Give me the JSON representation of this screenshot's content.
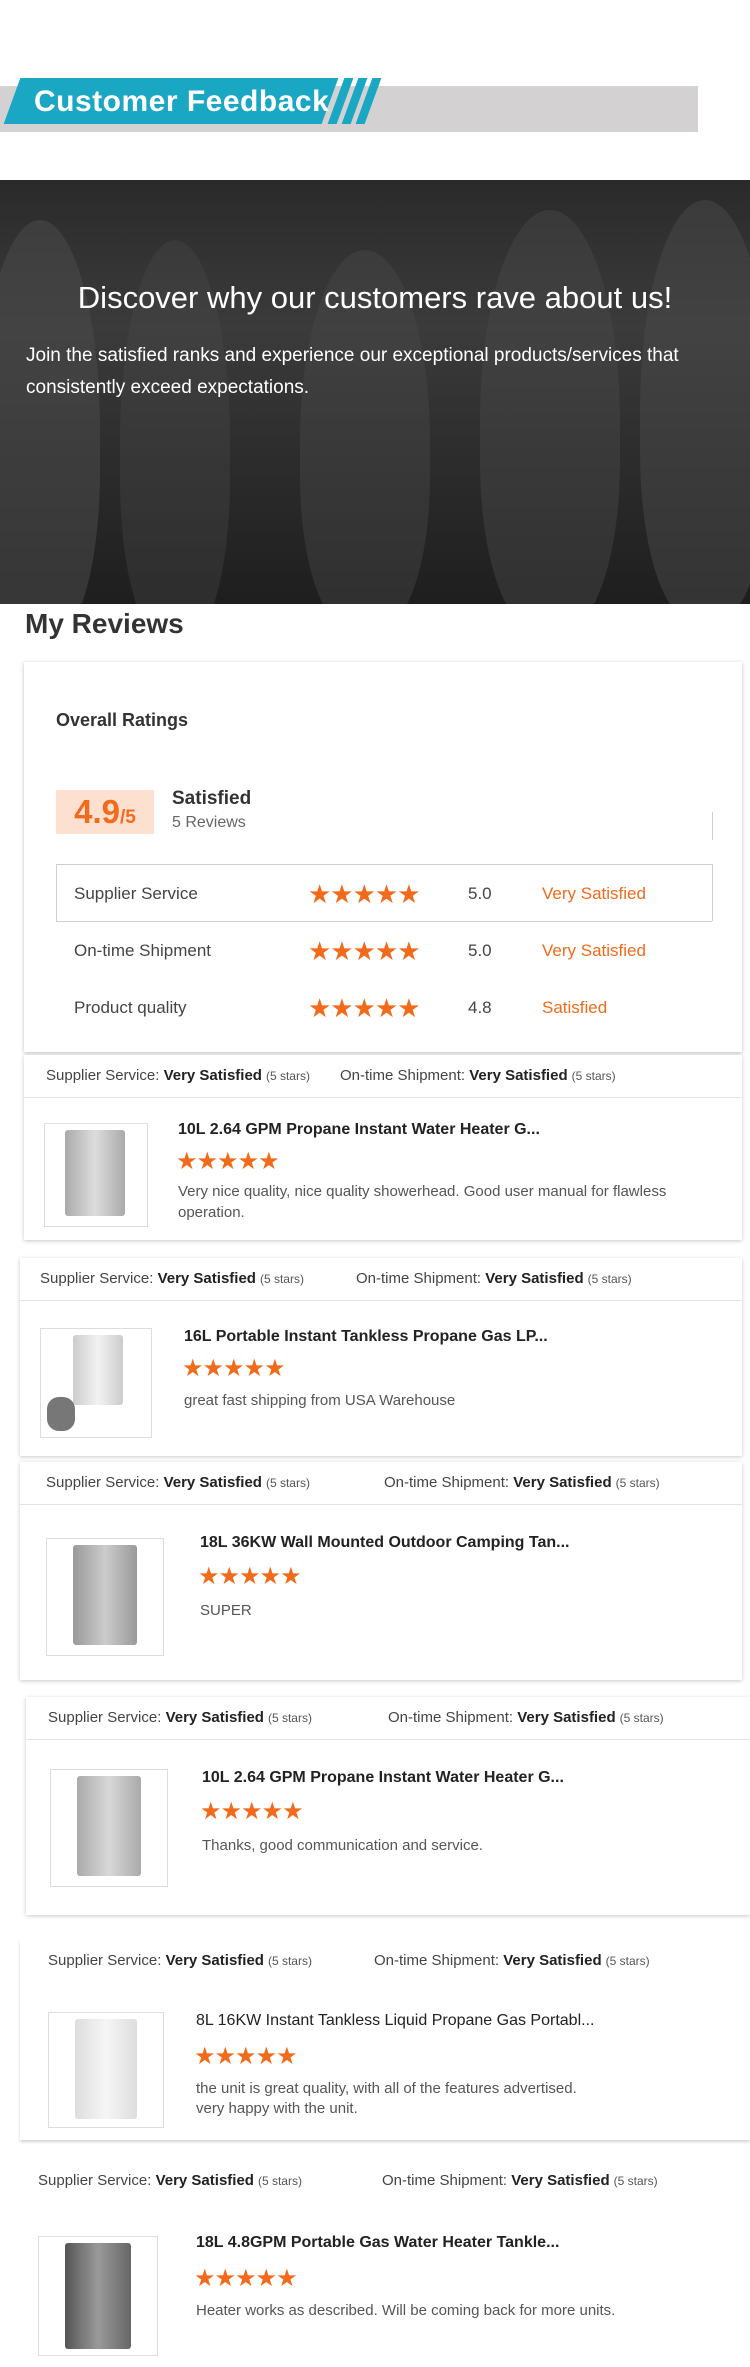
{
  "banner": {
    "title": "Customer Feedback"
  },
  "hero": {
    "title": "Discover why our customers rave about us!",
    "subtitle": "Join the satisfied ranks and experience our exceptional products/services that consistently exceed expectations."
  },
  "reviews_section": {
    "title": "My Reviews",
    "overall_label": "Overall Ratings",
    "score": "4.9",
    "score_suffix": "/5",
    "satisfaction": "Satisfied",
    "review_count": "5 Reviews",
    "rows": [
      {
        "name": "Supplier Service",
        "stars": "★★★★★",
        "value": "5.0",
        "label": "Very Satisfied"
      },
      {
        "name": "On-time Shipment",
        "stars": "★★★★★",
        "value": "5.0",
        "label": "Very Satisfied"
      },
      {
        "name": "Product quality",
        "stars": "★★★★★",
        "value": "4.8",
        "label": "Satisfied"
      }
    ]
  },
  "review_header": {
    "supplier_label": "Supplier Service:",
    "shipment_label": "On-time Shipment:",
    "value": "Very Satisfied",
    "stars_text": "(5 stars)"
  },
  "reviews": [
    {
      "product": "10L 2.64 GPM Propane Instant Water Heater G...",
      "stars": "★★★★★",
      "comment": "Very nice quality, nice quality showerhead. Good user manual for flawless operation."
    },
    {
      "product": "16L Portable Instant Tankless Propane Gas LP...",
      "stars": "★★★★★",
      "comment": "great fast shipping from USA Warehouse"
    },
    {
      "product": "18L 36KW Wall Mounted Outdoor Camping Tan...",
      "stars": "★★★★★",
      "comment": "SUPER"
    },
    {
      "product": "10L 2.64 GPM Propane Instant Water Heater G...",
      "stars": "★★★★★",
      "comment": "Thanks, good communication and service."
    },
    {
      "product": "8L 16KW Instant Tankless Liquid Propane Gas Portabl...",
      "stars": "★★★★★",
      "comment": "the unit is great quality, with all of the features advertised.",
      "comment2": "very happy with the unit."
    },
    {
      "product": "18L 4.8GPM Portable Gas Water Heater Tankle...",
      "stars": "★★★★★",
      "comment": "Heater works as described. Will be coming back for more units."
    }
  ],
  "colors": {
    "accent": "#f26a1b",
    "banner_blue": "#1aa7c4",
    "banner_gray": "#d3d1d2",
    "score_bg": "#fde0cf"
  }
}
